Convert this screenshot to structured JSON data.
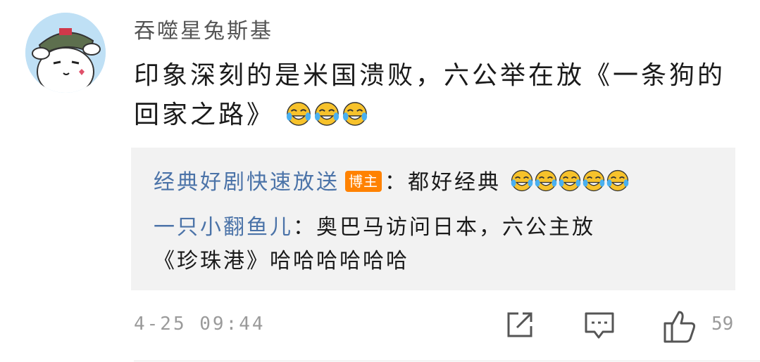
{
  "post": {
    "username": "吞噬星兔斯基",
    "text": "印象深刻的是米国溃败，六公举在放《一条狗的回家之路》",
    "emoji_name": "laughing-tears-emoji",
    "timestamp": "4-25 09:44",
    "like_count": "59"
  },
  "replies": [
    {
      "user": "经典好剧快速放送",
      "badge": "博主",
      "text": "：都好经典",
      "emoji_count": 5
    },
    {
      "user": "一只小翻鱼儿",
      "text": "：奥巴马访问日本，六公主放",
      "text_line2": "《珍珠港》哈哈哈哈哈哈"
    }
  ],
  "colors": {
    "username": "#555555",
    "reply_user": "#4b73a8",
    "badge": "#ff8200",
    "reply_bg": "#f2f2f2",
    "meta": "#9a9a9a"
  },
  "icons": {
    "share": "share-icon",
    "comment": "comment-icon",
    "like": "thumbs-up-icon"
  }
}
